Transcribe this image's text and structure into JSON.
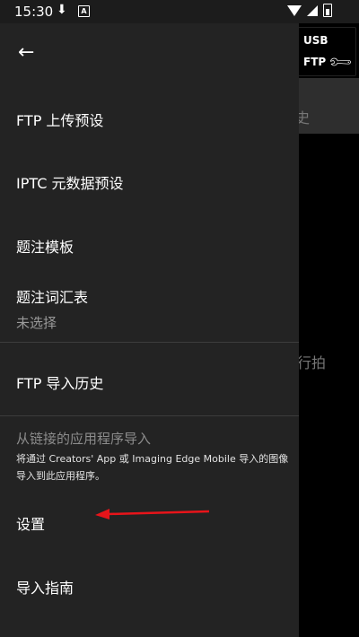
{
  "status_bar": {
    "time": "15:30"
  },
  "connection": {
    "usb_label": "USB",
    "ftp_label": "FTP"
  },
  "background": {
    "text1": "史",
    "text2": "行拍"
  },
  "drawer": {
    "items": [
      {
        "label": "FTP 上传预设"
      },
      {
        "label": "IPTC 元数据预设"
      },
      {
        "label": "题注模板"
      },
      {
        "label": "题注词汇表",
        "sub": "未选择"
      },
      {
        "label": "FTP 导入历史"
      }
    ],
    "import_section": {
      "title": "从链接的应用程序导入",
      "note": "将通过 Creators' App 或 Imaging Edge Mobile 导入的图像导入到此应用程序。"
    },
    "settings_label": "设置",
    "guide_label": "导入指南"
  },
  "colors": {
    "drawer_bg": "#232323",
    "annotation_arrow": "#e8141a"
  }
}
